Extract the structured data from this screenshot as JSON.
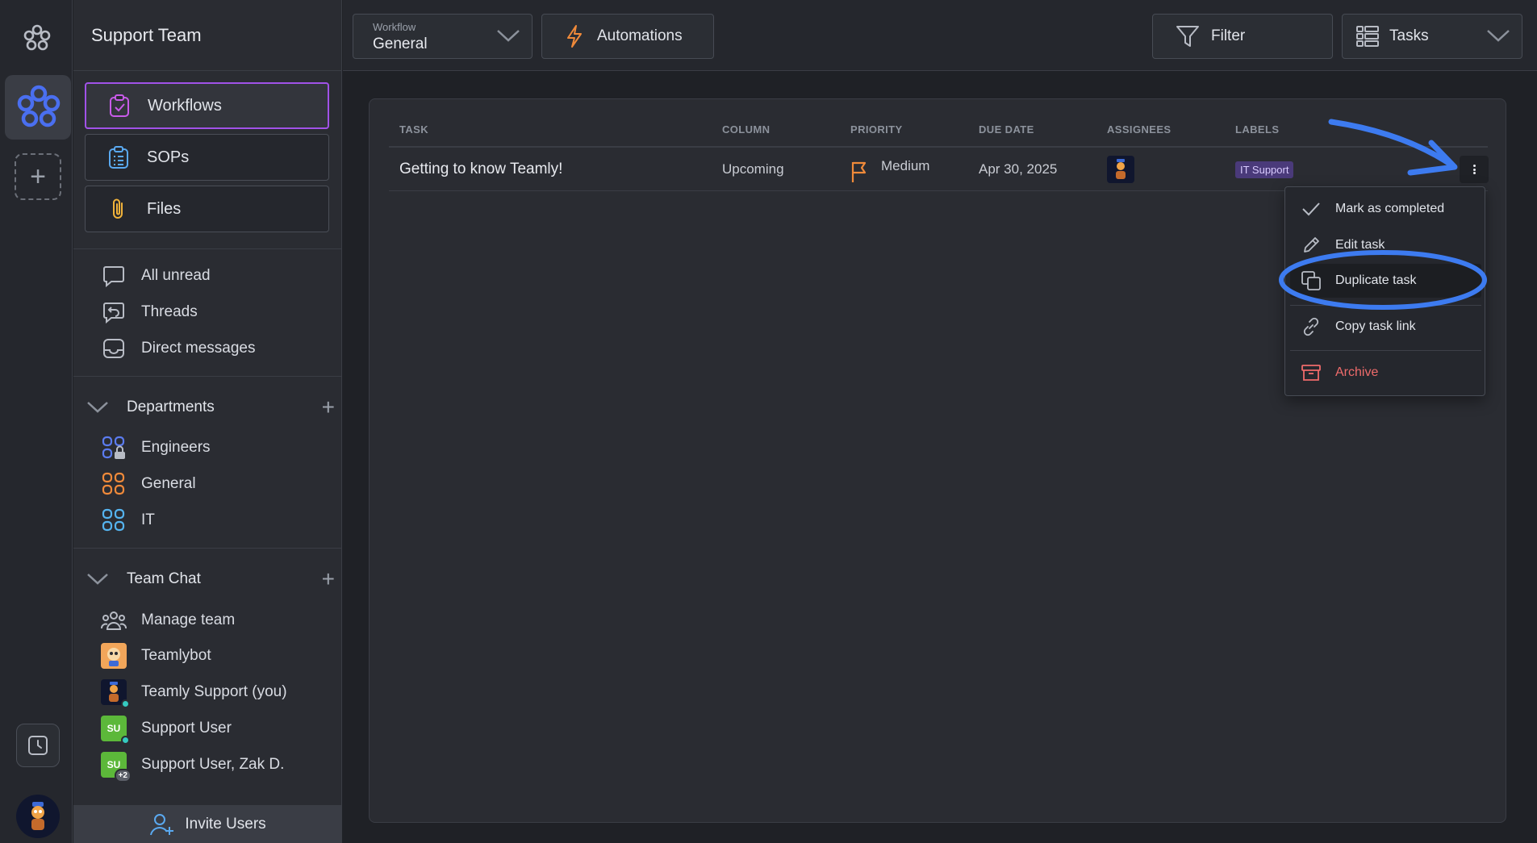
{
  "sidebar": {
    "team_name": "Support Team",
    "nav": [
      {
        "label": "Workflows",
        "icon": "clipboard-check-icon",
        "active": true
      },
      {
        "label": "SOPs",
        "icon": "clipboard-list-icon",
        "active": false
      },
      {
        "label": "Files",
        "icon": "paperclip-icon",
        "active": false
      }
    ],
    "inbox": [
      {
        "label": "All unread",
        "icon": "chat-bubble-icon"
      },
      {
        "label": "Threads",
        "icon": "thread-icon"
      },
      {
        "label": "Direct messages",
        "icon": "inbox-icon"
      }
    ],
    "departments": {
      "title": "Departments",
      "items": [
        {
          "label": "Engineers",
          "icon": "grid-lock-icon",
          "color": "#5b7cf0"
        },
        {
          "label": "General",
          "icon": "grid-icon",
          "color": "#f08a3a"
        },
        {
          "label": "IT",
          "icon": "grid-icon",
          "color": "#55b4f0"
        }
      ]
    },
    "team_chat": {
      "title": "Team Chat",
      "items": [
        {
          "label": "Manage team",
          "icon": "people-icon"
        },
        {
          "label": "Teamlybot",
          "icon": "bot-avatar"
        },
        {
          "label": "Teamly Support (you)",
          "icon": "user-avatar"
        },
        {
          "label": "Support User",
          "initials": "SU"
        },
        {
          "label": "Support User, Zak D.",
          "initials": "SU",
          "extra": "+2"
        }
      ]
    },
    "invite_label": "Invite Users"
  },
  "topbar": {
    "workflow_label": "Workflow",
    "workflow_value": "General",
    "automations_label": "Automations",
    "filter_label": "Filter",
    "view_label": "Tasks"
  },
  "table": {
    "columns": [
      "TASK",
      "COLUMN",
      "PRIORITY",
      "DUE DATE",
      "ASSIGNEES",
      "LABELS"
    ],
    "rows": [
      {
        "task": "Getting to know Teamly!",
        "column": "Upcoming",
        "priority": "Medium",
        "due_date": "Apr 30, 2025",
        "label": "IT Support"
      }
    ]
  },
  "context_menu": {
    "items": [
      {
        "label": "Mark as completed",
        "icon": "check-icon"
      },
      {
        "label": "Edit task",
        "icon": "pencil-icon"
      },
      {
        "label": "Duplicate task",
        "icon": "duplicate-icon",
        "highlighted": true
      },
      {
        "label": "Copy task link",
        "icon": "link-icon"
      },
      {
        "label": "Archive",
        "icon": "archive-icon",
        "danger": true
      }
    ]
  },
  "colors": {
    "accent_purple": "#a152e8",
    "annotation_blue": "#3d7bf0",
    "danger": "#ef6b6b",
    "priority_orange": "#f08a3a"
  }
}
